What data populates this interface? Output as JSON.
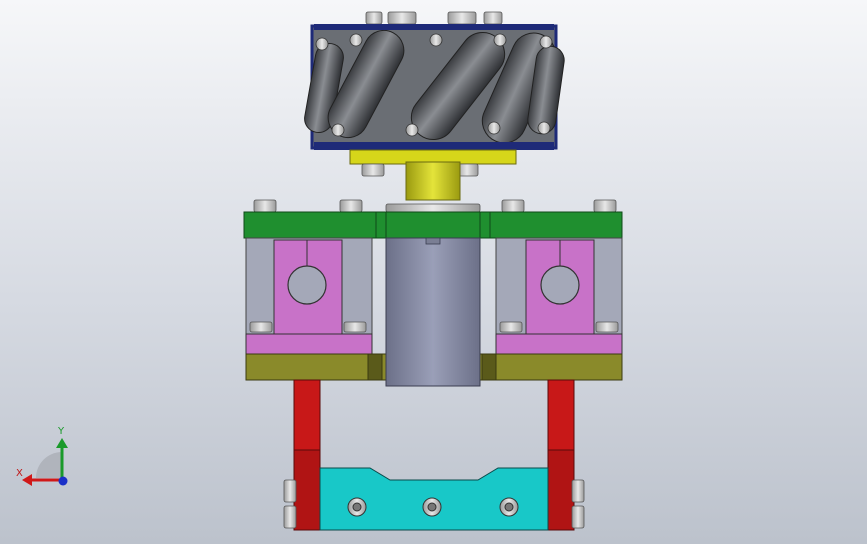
{
  "view": {
    "background_top": "#f6f7f9",
    "background_bottom": "#bcc2cc"
  },
  "triad": {
    "x_label": "X",
    "y_label": "Y",
    "x_color": "#d01818",
    "y_color": "#1a9a2a",
    "z_color": "#1a30c8"
  },
  "parts": [
    {
      "name": "mecanum-wheel",
      "color": "#1e2a78"
    },
    {
      "name": "wheel-roller",
      "color": "#5a5d62"
    },
    {
      "name": "wheel-hub-flange",
      "color": "#d6d61a"
    },
    {
      "name": "motor-coupling",
      "color": "#c8c81a"
    },
    {
      "name": "top-mount-plate",
      "color": "#1f8f2f"
    },
    {
      "name": "shaft-support-block",
      "color": "#c872c8"
    },
    {
      "name": "motor-body",
      "color": "#8a8fa8"
    },
    {
      "name": "base-plate",
      "color": "#8a8a2a"
    },
    {
      "name": "suspension-arm",
      "color": "#c81818"
    },
    {
      "name": "suspension-link-block",
      "color": "#18c8c8"
    }
  ]
}
